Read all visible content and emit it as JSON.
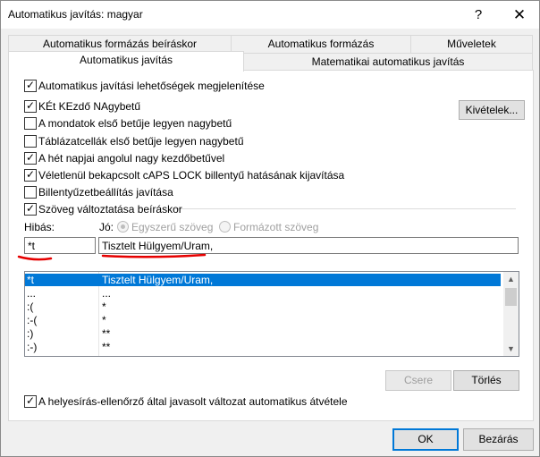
{
  "window": {
    "title": "Automatikus javítás: magyar",
    "help_glyph": "?",
    "close_glyph": "✕"
  },
  "tabs_back": [
    {
      "label": "Automatikus formázás beíráskor"
    },
    {
      "label": "Automatikus formázás"
    },
    {
      "label": "Műveletek"
    }
  ],
  "tabs_front": [
    {
      "label": "Automatikus javítás",
      "active": true
    },
    {
      "label": "Matematikai automatikus javítás",
      "active": false
    }
  ],
  "options": {
    "show_buttons": {
      "label": "Automatikus javítási lehetőségek megjelenítése",
      "checked": true
    },
    "two_initials": {
      "label": "KÉt KEzdő NAgybetű",
      "checked": true
    },
    "sentence_first": {
      "label": "A mondatok első betűje legyen nagybetű",
      "checked": false
    },
    "table_cell_first": {
      "label": "Táblázatcellák első betűje legyen nagybetű",
      "checked": false
    },
    "day_names": {
      "label": "A hét napjai angolul nagy kezdőbetűvel",
      "checked": true
    },
    "caps_lock": {
      "label": "Véletlenül bekapcsolt cAPS LOCK billentyű hatásának kijavítása",
      "checked": true
    },
    "keyboard": {
      "label": "Billentyűzetbeállítás javítása",
      "checked": false
    },
    "replace_text": {
      "label": "Szöveg változtatása beíráskor",
      "checked": true
    },
    "spellcheck_suggest": {
      "label": "A helyesírás-ellenőrző által javasolt változat automatikus átvétele",
      "checked": true
    }
  },
  "exceptions_button": "Kivételek...",
  "replace": {
    "wrong_label": "Hibás:",
    "right_label": "Jó:",
    "radio_plain": "Egyszerű szöveg",
    "radio_formatted": "Formázott szöveg",
    "wrong_value": "*t",
    "right_value": "Tisztelt Hülgyem/Uram,"
  },
  "entries": [
    {
      "from": "*t",
      "to": "Tisztelt Hülgyem/Uram,",
      "selected": true
    },
    {
      "from": "...",
      "to": "...",
      "selected": false
    },
    {
      "from": ":(",
      "to": "*",
      "selected": false
    },
    {
      "from": ":-(",
      "to": "*",
      "selected": false
    },
    {
      "from": ":)",
      "to": "**",
      "selected": false
    },
    {
      "from": ":-)",
      "to": "**",
      "selected": false
    }
  ],
  "buttons": {
    "replace": "Csere",
    "delete": "Törlés",
    "ok": "OK",
    "cancel": "Bezárás"
  },
  "colors": {
    "selection": "#0078d7",
    "annotation": "#e60000"
  },
  "check_glyph": "✓"
}
